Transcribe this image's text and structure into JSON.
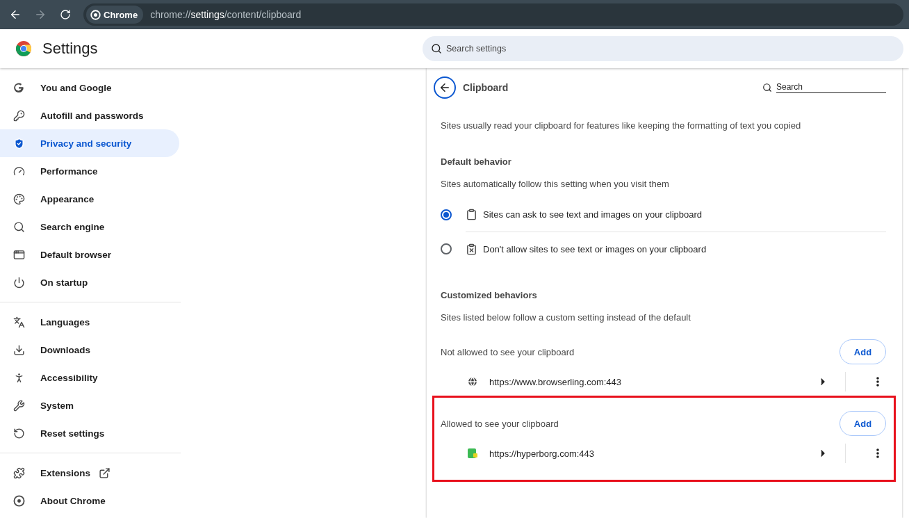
{
  "browser": {
    "back_disabled": false,
    "forward_disabled": true,
    "chip": "Chrome",
    "url_scheme": "chrome://",
    "url_host": "settings",
    "url_path": "/content/clipboard"
  },
  "header": {
    "title": "Settings",
    "search": {
      "placeholder": "Search settings"
    }
  },
  "sidebar": {
    "groups": [
      [
        {
          "label": "You and Google",
          "selected": false
        },
        {
          "label": "Autofill and passwords",
          "selected": false
        },
        {
          "label": "Privacy and security",
          "selected": true
        },
        {
          "label": "Performance",
          "selected": false
        },
        {
          "label": "Appearance",
          "selected": false
        },
        {
          "label": "Search engine",
          "selected": false
        },
        {
          "label": "Default browser",
          "selected": false
        },
        {
          "label": "On startup",
          "selected": false
        }
      ],
      [
        {
          "label": "Languages",
          "selected": false
        },
        {
          "label": "Downloads",
          "selected": false
        },
        {
          "label": "Accessibility",
          "selected": false
        },
        {
          "label": "System",
          "selected": false
        },
        {
          "label": "Reset settings",
          "selected": false
        }
      ],
      [
        {
          "label": "Extensions",
          "selected": false,
          "external": true
        },
        {
          "label": "About Chrome",
          "selected": false
        }
      ]
    ]
  },
  "page": {
    "title": "Clipboard",
    "search": {
      "placeholder": "Search"
    },
    "description": "Sites usually read your clipboard for features like keeping the formatting of text you copied",
    "default_behavior": {
      "heading": "Default behavior",
      "subtitle": "Sites automatically follow this setting when you visit them",
      "options": [
        {
          "label": "Sites can ask to see text and images on your clipboard",
          "selected": true
        },
        {
          "label": "Don't allow sites to see text or images on your clipboard",
          "selected": false
        }
      ]
    },
    "customized": {
      "heading": "Customized behaviors",
      "subtitle": "Sites listed below follow a custom setting instead of the default",
      "groups": [
        {
          "label": "Not allowed to see your clipboard",
          "button": "Add",
          "highlighted": false,
          "sites": [
            {
              "url": "https://www.browserling.com:443"
            }
          ]
        },
        {
          "label": "Allowed to see your clipboard",
          "button": "Add",
          "highlighted": true,
          "sites": [
            {
              "url": "https://hyperborg.com:443"
            }
          ]
        }
      ]
    }
  }
}
